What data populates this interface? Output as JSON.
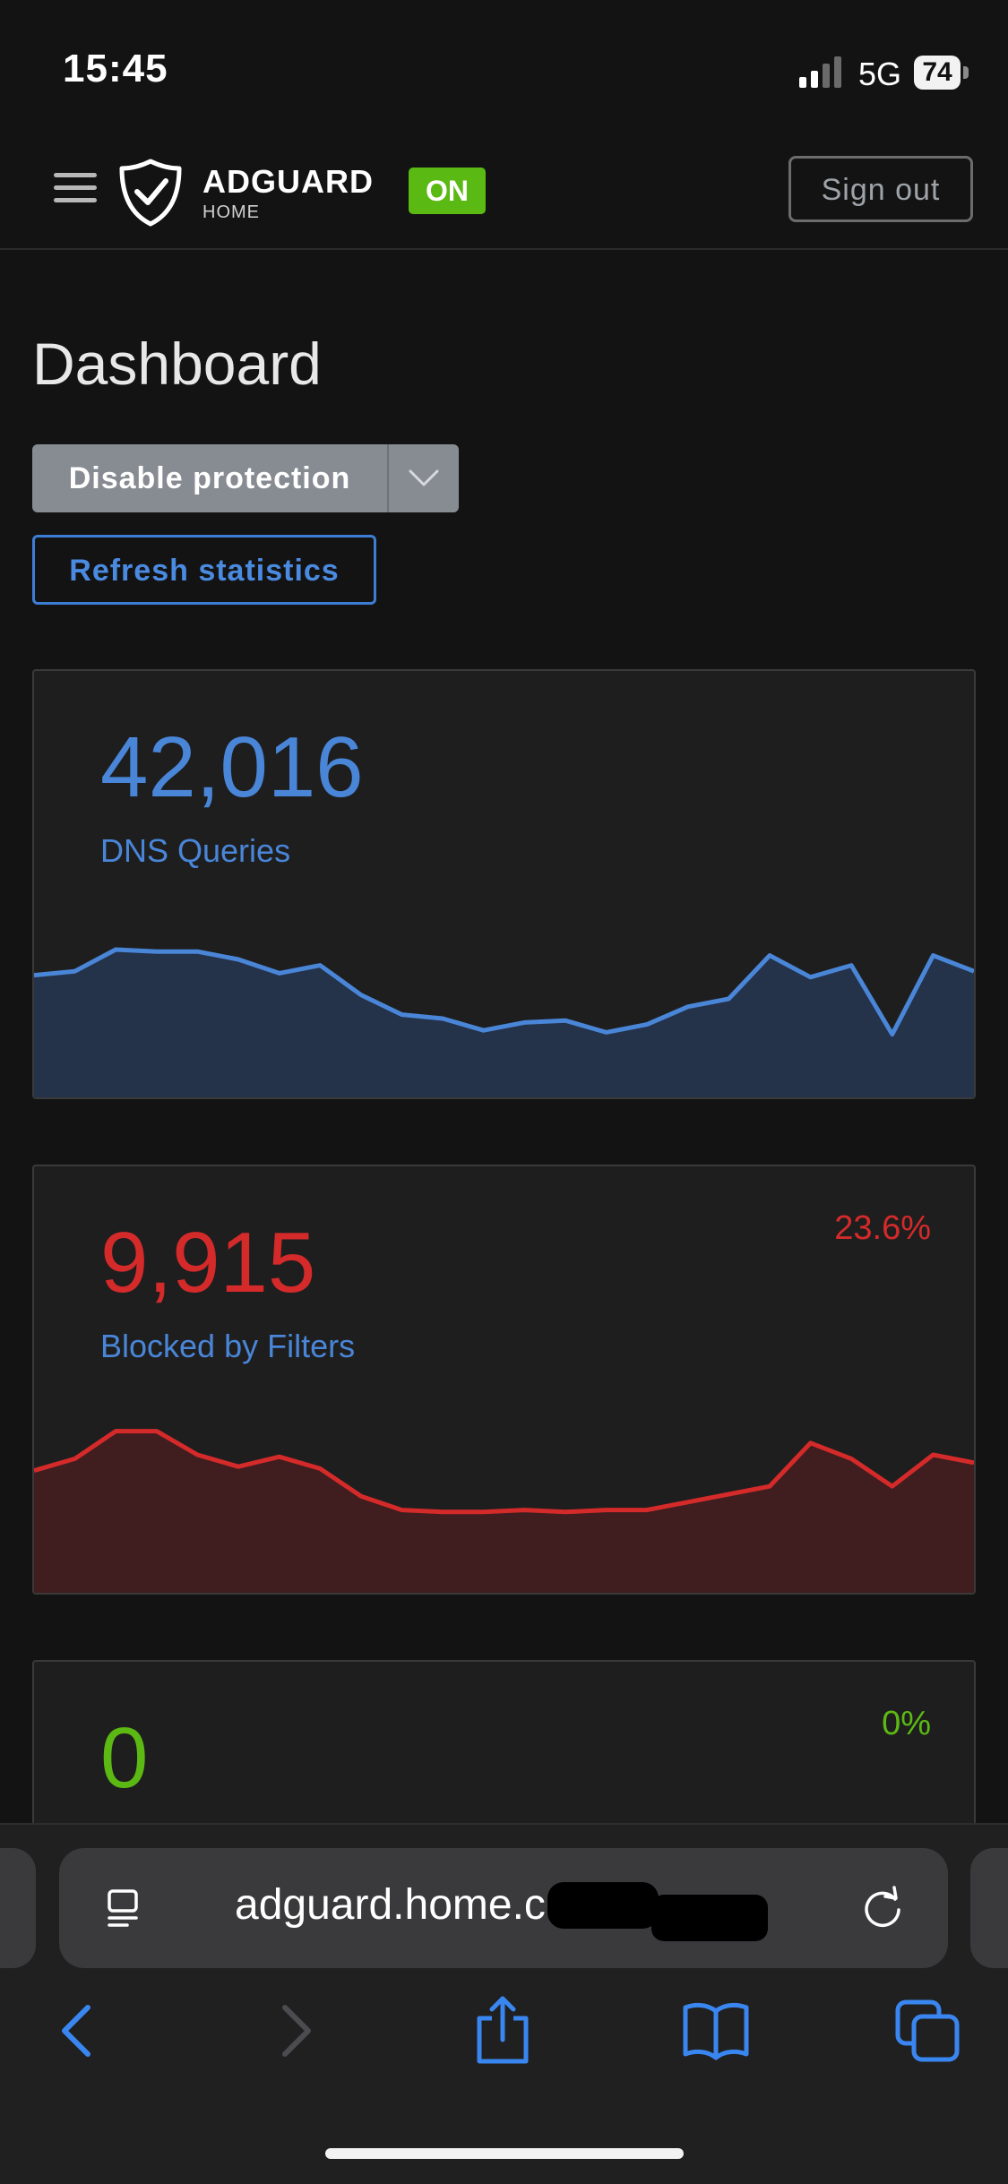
{
  "status_bar": {
    "time": "15:45",
    "network": "5G",
    "battery": "74"
  },
  "header": {
    "brand_name": "ADGUARD",
    "brand_sub": "HOME",
    "badge": "ON",
    "sign_out": "Sign out"
  },
  "page": {
    "title": "Dashboard",
    "disable_protection": "Disable protection",
    "refresh_statistics": "Refresh statistics"
  },
  "cards": [
    {
      "value": "42,016",
      "label": "DNS Queries",
      "percent": "",
      "color": "#4a86d8",
      "fill": "#24324a"
    },
    {
      "value": "9,915",
      "label": "Blocked by Filters",
      "percent": "23.6%",
      "color": "#d42a2a",
      "fill": "#401d1e"
    },
    {
      "value": "0",
      "label": "",
      "percent": "0%",
      "color": "#5cb914",
      "fill": "#1e1e1f"
    }
  ],
  "chart_data": [
    {
      "type": "area",
      "title": "DNS Queries",
      "series": [
        {
          "values": [
            62,
            64,
            75,
            74,
            74,
            70,
            63,
            67,
            52,
            42,
            40,
            34,
            38,
            39,
            33,
            37,
            46,
            50,
            72,
            61,
            67,
            32,
            72,
            64
          ]
        }
      ],
      "ylim": [
        0,
        100
      ]
    },
    {
      "type": "area",
      "title": "Blocked by Filters",
      "series": [
        {
          "values": [
            62,
            68,
            82,
            82,
            70,
            64,
            69,
            63,
            49,
            42,
            41,
            41,
            42,
            41,
            42,
            42,
            46,
            50,
            54,
            76,
            68,
            54,
            70,
            66
          ]
        }
      ],
      "ylim": [
        0,
        100
      ]
    }
  ],
  "safari": {
    "url": "adguard.home.c"
  },
  "icons": {
    "menu": "hamburger-icon",
    "logo": "adguard-shield-icon",
    "caret": "chevron-down-icon",
    "reader": "reader-icon",
    "reload": "reload-icon",
    "back": "back-arrow-icon",
    "forward": "forward-arrow-icon",
    "share": "share-icon",
    "bookmarks": "bookmarks-icon",
    "tabs": "tabs-icon"
  }
}
